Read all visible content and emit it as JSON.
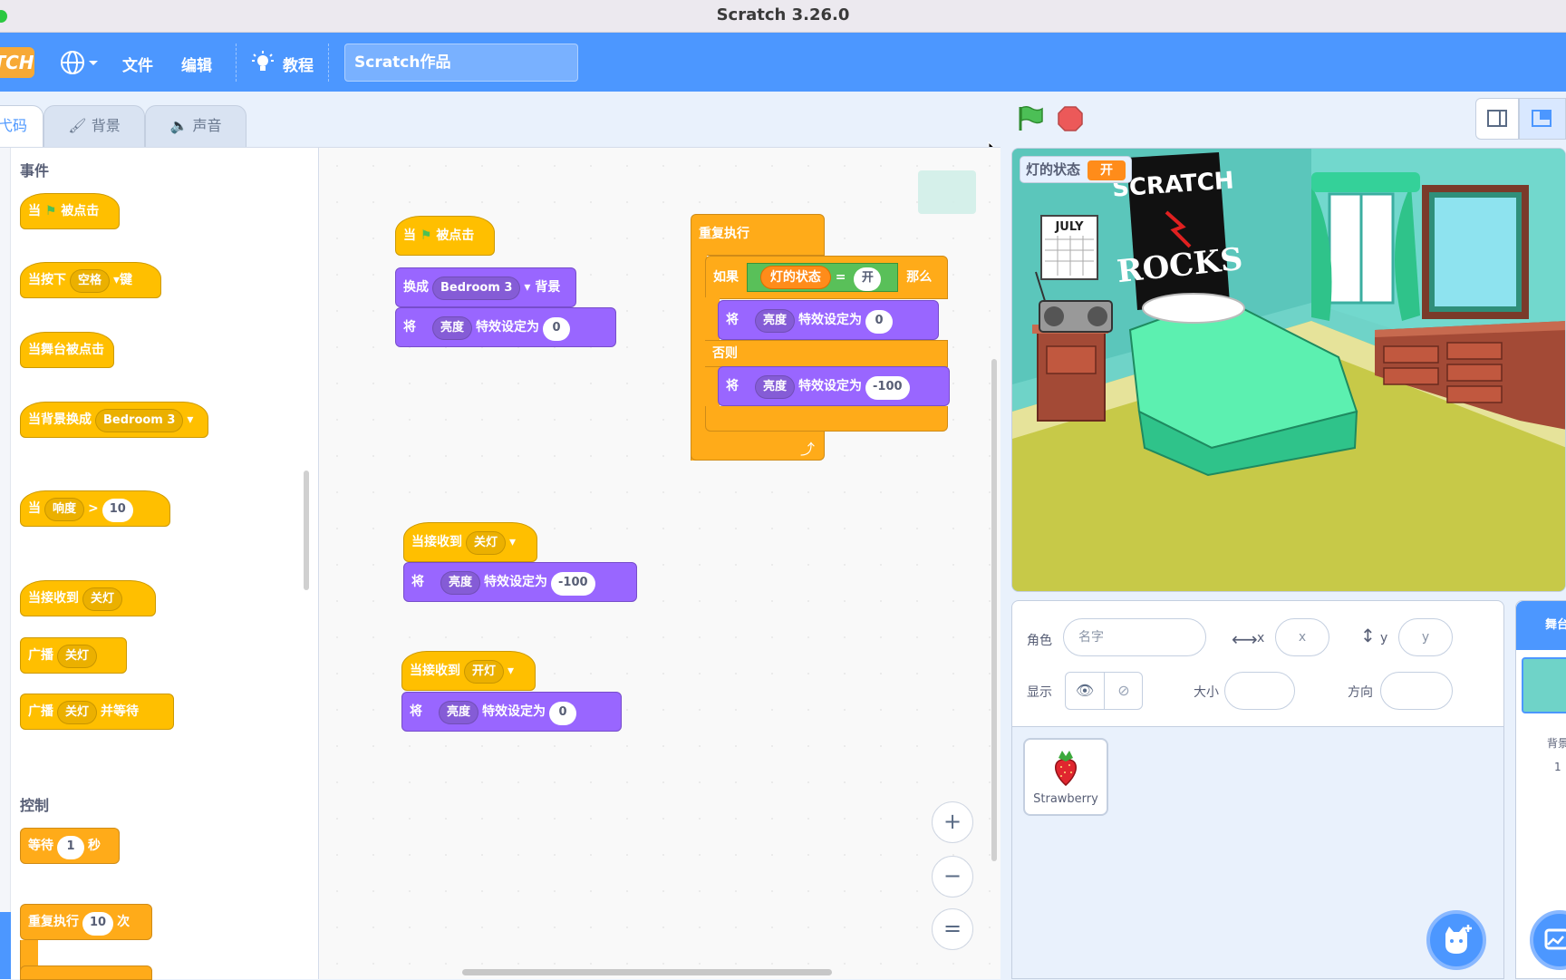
{
  "window": {
    "title": "Scratch 3.26.0"
  },
  "menubar": {
    "logo": "TCH",
    "file": "文件",
    "edit": "编辑",
    "tutorials": "教程",
    "project_title": "Scratch作品"
  },
  "tabs": [
    {
      "label": "弋码",
      "active": true
    },
    {
      "label": "背景",
      "active": false
    },
    {
      "label": "声音",
      "active": false
    }
  ],
  "palette": {
    "events_title": "事件",
    "control_title": "控制",
    "blocks": {
      "flag_clicked_pre": "当",
      "flag_clicked_post": "被点击",
      "key_pressed_pre": "当按下",
      "key_pressed_key": "空格",
      "key_pressed_post": "键",
      "stage_clicked": "当舞台被点击",
      "backdrop_switch": "当背景换成",
      "backdrop_switch_val": "Bedroom 3",
      "when_pre": "当",
      "when_sensor": "响度",
      "when_op": ">",
      "when_val": "10",
      "receive": "当接收到",
      "receive_msg": "关灯",
      "broadcast": "广播",
      "broadcast_msg": "关灯",
      "broadcast_wait": "广播",
      "broadcast_wait_msg": "关灯",
      "broadcast_wait_post": "并等待",
      "wait_pre": "等待",
      "wait_val": "1",
      "wait_post": "秒",
      "repeat_pre": "重复执行",
      "repeat_val": "10",
      "repeat_post": "次"
    }
  },
  "scripts": {
    "s1": {
      "hat_pre": "当",
      "hat_post": "被点击",
      "switch_pre": "换成",
      "switch_val": "Bedroom 3",
      "switch_post": "背景",
      "set_pre": "将",
      "set_effect": "亮度",
      "set_mid": "特效设定为",
      "set_val": "0"
    },
    "s2": {
      "forever": "重复执行",
      "if": "如果",
      "var": "灯的状态",
      "eq": "=",
      "eq_val": "开",
      "then": "那么",
      "set1_pre": "将",
      "set1_effect": "亮度",
      "set1_mid": "特效设定为",
      "set1_val": "0",
      "else": "否则",
      "set2_pre": "将",
      "set2_effect": "亮度",
      "set2_mid": "特效设定为",
      "set2_val": "-100"
    },
    "s3": {
      "hat": "当接收到",
      "msg": "关灯",
      "set_pre": "将",
      "set_effect": "亮度",
      "set_mid": "特效设定为",
      "set_val": "-100"
    },
    "s4": {
      "hat": "当接收到",
      "msg": "开灯",
      "set_pre": "将",
      "set_effect": "亮度",
      "set_mid": "特效设定为",
      "set_val": "0"
    }
  },
  "zoom": {
    "in": "+",
    "out": "−",
    "reset": "="
  },
  "stage": {
    "var_name": "灯的状态",
    "var_value": "开",
    "calendar": "JULY",
    "poster_1": "SCRATCH",
    "poster_2": "ROCKS"
  },
  "sprite_info": {
    "sprite_label": "角色",
    "name_placeholder": "名字",
    "x_label": "x",
    "x_placeholder": "x",
    "y_label": "y",
    "y_placeholder": "y",
    "show_label": "显示",
    "size_label": "大小",
    "direction_label": "方向"
  },
  "sprites": [
    {
      "name": "Strawberry"
    }
  ],
  "stage_panel": {
    "title": "舞台",
    "backdrops_label": "背景",
    "backdrops_count": "1"
  },
  "colors": {
    "accent": "#4c97ff",
    "events": "#ffbf00",
    "looks": "#9966ff",
    "control": "#ffab19",
    "operators": "#59c059",
    "variables": "#ff8c1a"
  }
}
